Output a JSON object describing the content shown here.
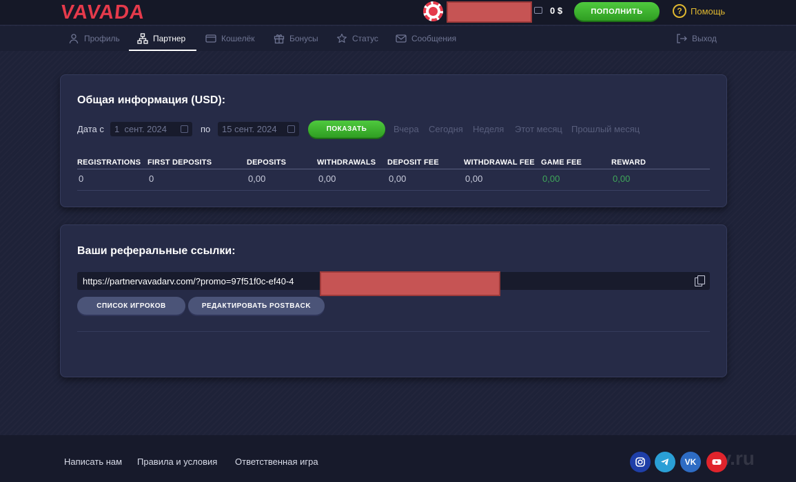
{
  "header": {
    "logo": "VAVADA",
    "balance": "0 $",
    "deposit_label": "ПОПОЛНИТЬ",
    "help_label": "Помощь"
  },
  "nav": {
    "items": [
      {
        "label": "Профиль",
        "icon": "user-icon"
      },
      {
        "label": "Партнер",
        "icon": "network-icon"
      },
      {
        "label": "Кошелёк",
        "icon": "wallet-icon"
      },
      {
        "label": "Бонусы",
        "icon": "gift-icon"
      },
      {
        "label": "Статус",
        "icon": "star-icon"
      },
      {
        "label": "Сообщения",
        "icon": "mail-icon"
      }
    ],
    "active": "Партнер",
    "logout_label": "Выход"
  },
  "general_info": {
    "title": "Общая информация (USD):",
    "date_from_label": "Дата с",
    "date_from_value": "1  сент. 2024",
    "date_to_label": "по",
    "date_to_value": "15 сент. 2024",
    "show_label": "ПОКАЗАТЬ",
    "periods": [
      "Вчера",
      "Сегодня",
      "Неделя",
      "Этот месяц",
      "Прошлый месяц"
    ],
    "columns": [
      "REGISTRATIONS",
      "FIRST DEPOSITS",
      "DEPOSITS",
      "WITHDRAWALS",
      "DEPOSIT FEE",
      "WITHDRAWAL FEE",
      "GAME FEE",
      "REWARD"
    ],
    "values": [
      "0",
      "0",
      "0,00",
      "0,00",
      "0,00",
      "0,00",
      "0,00",
      "0,00"
    ]
  },
  "referral": {
    "title": "Ваши реферальные ссылки:",
    "link": "https://partnervavadarv.com/?promo=97f51f0c-ef40-4",
    "players_label": "СПИСОК ИГРОКОВ",
    "postback_label": "РЕДАКТИРОВАТЬ POSTBACK"
  },
  "footer": {
    "links": [
      "Написать нам",
      "Правила и условия",
      "Ответственная игра"
    ],
    "social": [
      "instagram-icon",
      "telegram-icon",
      "vk-icon",
      "youtube-icon"
    ],
    "watermark": "vv.ru"
  },
  "colors": {
    "accent_green": "#3fb82f",
    "brand_red": "#e53a4b",
    "help_gold": "#e0b830",
    "positive_value": "#3fa85a"
  }
}
